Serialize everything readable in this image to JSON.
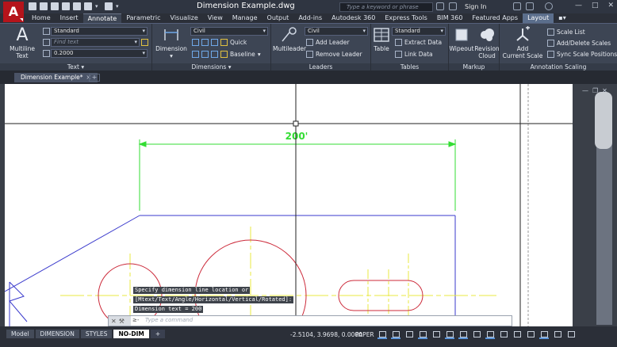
{
  "app": {
    "logo_letter": "A",
    "document_title": "Dimension Example.dwg",
    "search_placeholder": "Type a keyword or phrase",
    "signin_label": "Sign In"
  },
  "ribbon_tabs": [
    {
      "label": "Home"
    },
    {
      "label": "Insert"
    },
    {
      "label": "Annotate",
      "active": true
    },
    {
      "label": "Parametric"
    },
    {
      "label": "Visualize"
    },
    {
      "label": "View"
    },
    {
      "label": "Manage"
    },
    {
      "label": "Output"
    },
    {
      "label": "Add-ins"
    },
    {
      "label": "Autodesk 360"
    },
    {
      "label": "Express Tools"
    },
    {
      "label": "BIM 360"
    },
    {
      "label": "Featured Apps"
    },
    {
      "label": "Layout"
    }
  ],
  "panels": {
    "text": {
      "label": "Text",
      "multiline_label_1": "Multiline",
      "multiline_label_2": "Text",
      "style_value": "Standard",
      "find_placeholder": "Find text",
      "height_value": "0.2000"
    },
    "dimensions": {
      "label": "Dimensions",
      "dimension_label": "Dimension",
      "style_value": "Civil",
      "quick_label": "Quick",
      "baseline_label": "Baseline"
    },
    "leaders": {
      "label": "Leaders",
      "multileader_label": "Multileader",
      "style_value": "Civil",
      "add_leader_label": "Add Leader",
      "remove_leader_label": "Remove Leader"
    },
    "tables": {
      "label": "Tables",
      "table_label": "Table",
      "style_value": "Standard",
      "extract_label": "Extract Data",
      "link_label": "Link Data"
    },
    "markup": {
      "label": "Markup",
      "wipeout_label": "Wipeout",
      "revision_label_1": "Revision",
      "revision_label_2": "Cloud"
    },
    "annotation_scaling": {
      "label": "Annotation Scaling",
      "add_scale_label_1": "Add",
      "add_scale_label_2": "Current Scale",
      "scale_list_label": "Scale List",
      "add_delete_label": "Add/Delete Scales",
      "sync_label": "Sync Scale Positions"
    }
  },
  "file_tab": {
    "label": "Dimension Example*",
    "close": "×",
    "plus": "+"
  },
  "drawing": {
    "dimension_text": "200'",
    "colors": {
      "dimension": "#33dd33",
      "outline": "#3a3acc",
      "circles": "#cc2a3a",
      "centerlines": "#e8e840",
      "crosshair": "#222222"
    }
  },
  "command": {
    "history": [
      "Specify dimension line location or",
      "[Mtext/Text/Angle/Horizontal/Vertical/Rotated]:",
      "Dimension text = 200"
    ],
    "prompt_symbol": "≥-",
    "input_placeholder": "Type a command"
  },
  "status": {
    "layout_tabs": [
      {
        "label": "Model"
      },
      {
        "label": "DIMENSION"
      },
      {
        "label": "STYLES"
      },
      {
        "label": "NO-DIM",
        "active": true
      },
      {
        "label": "+"
      }
    ],
    "coordinates": "-2.5104, 3.9698, 0.0000",
    "space": "PAPER"
  }
}
